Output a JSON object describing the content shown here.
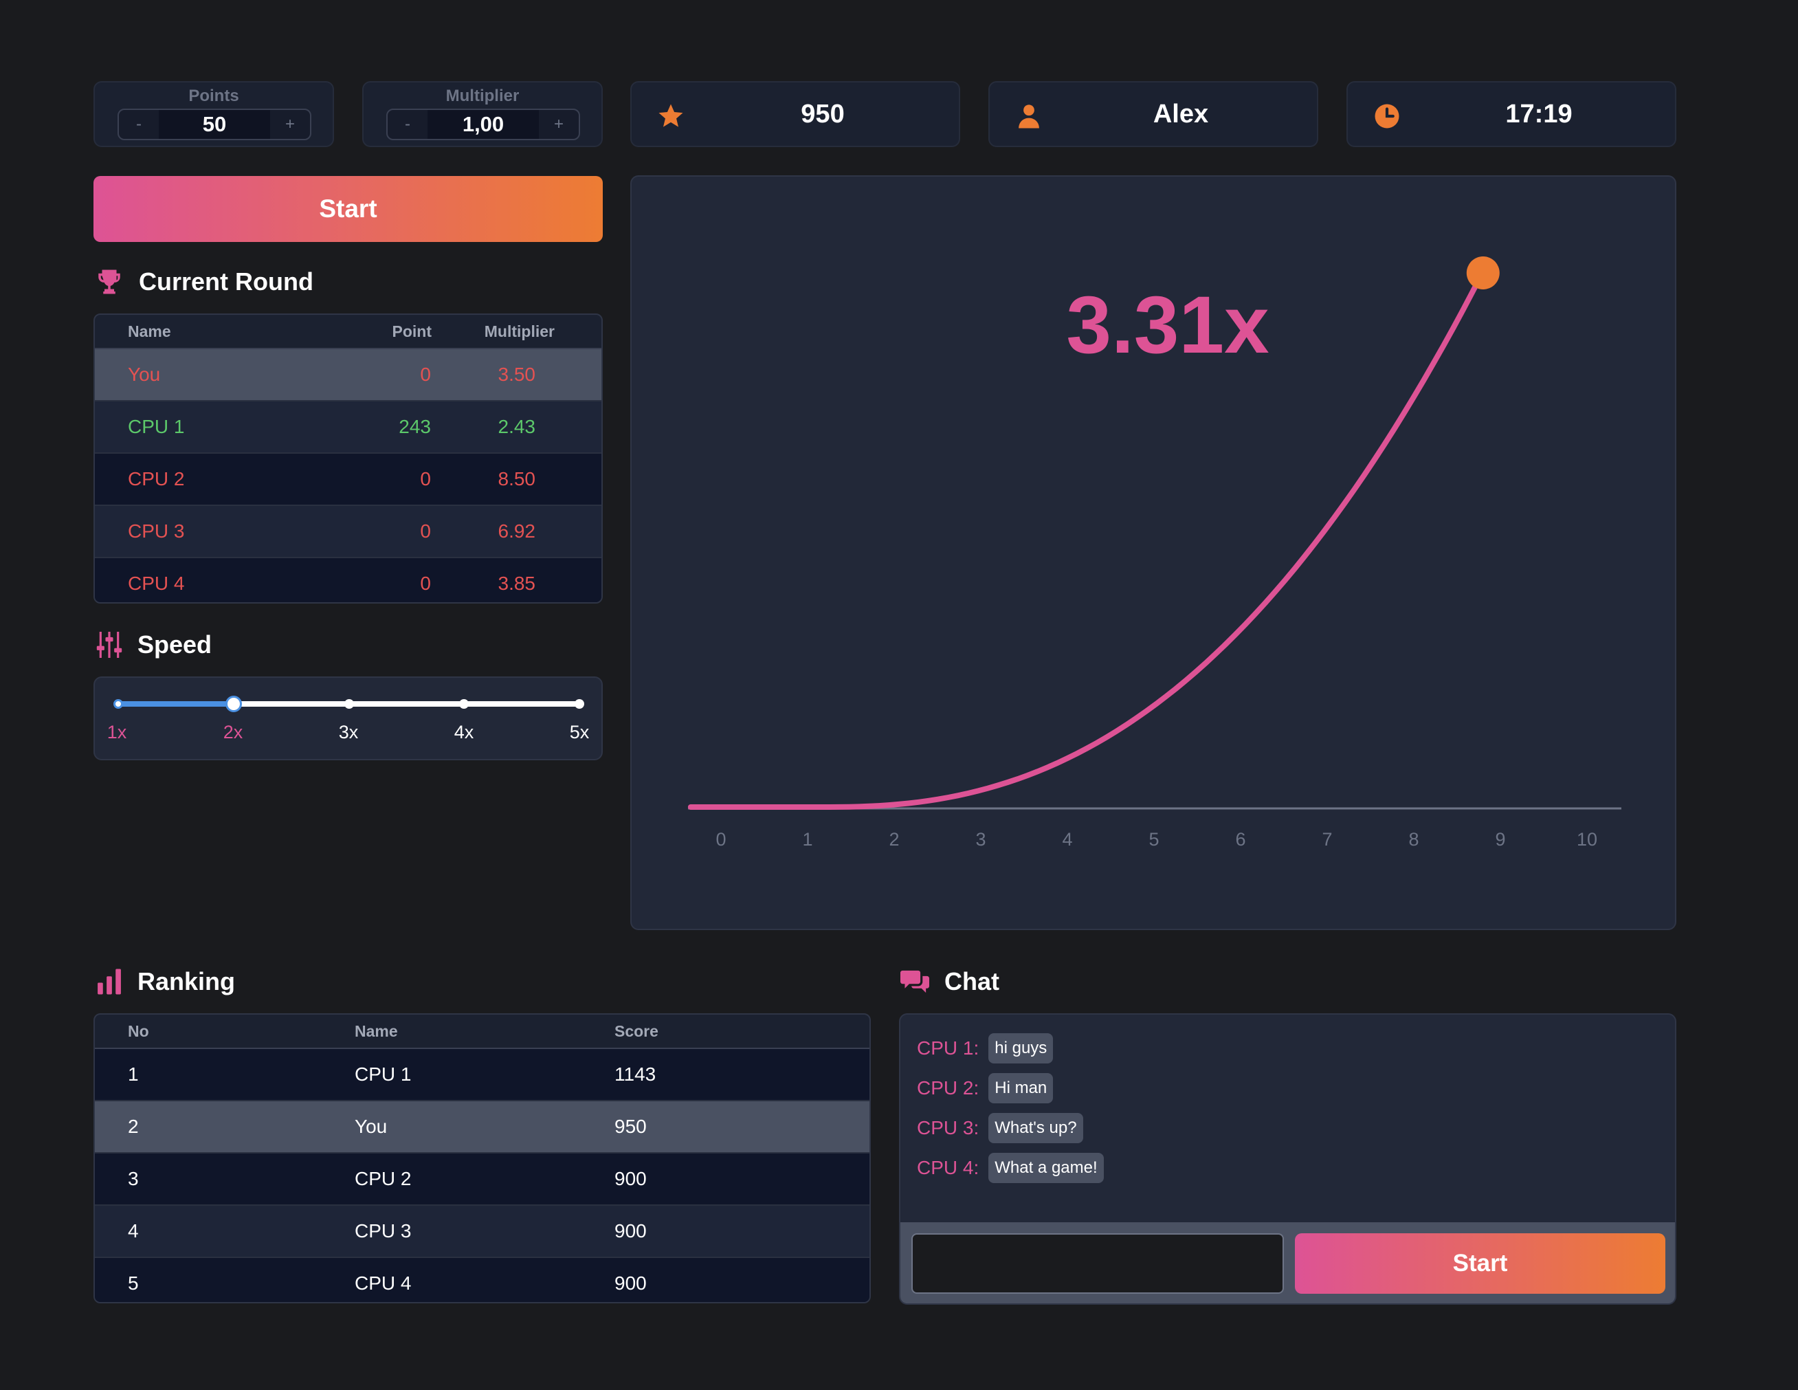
{
  "controls": {
    "points": {
      "label": "Points",
      "value": "50",
      "minus": "-",
      "plus": "+"
    },
    "multiplier": {
      "label": "Multiplier",
      "value": "1,00",
      "minus": "-",
      "plus": "+"
    }
  },
  "info": {
    "score": "950",
    "user": "Alex",
    "time": "17:19"
  },
  "start_label": "Start",
  "current_round": {
    "title": "Current Round",
    "columns": [
      "Name",
      "Point",
      "Multiplier"
    ],
    "rows": [
      {
        "name": "You",
        "point": "0",
        "multiplier": "3.50",
        "status": "red"
      },
      {
        "name": "CPU 1",
        "point": "243",
        "multiplier": "2.43",
        "status": "green"
      },
      {
        "name": "CPU 2",
        "point": "0",
        "multiplier": "8.50",
        "status": "red"
      },
      {
        "name": "CPU 3",
        "point": "0",
        "multiplier": "6.92",
        "status": "red"
      },
      {
        "name": "CPU 4",
        "point": "0",
        "multiplier": "3.85",
        "status": "red"
      }
    ]
  },
  "speed": {
    "title": "Speed",
    "options": [
      "1x",
      "2x",
      "3x",
      "4x",
      "5x"
    ],
    "selected": "2x"
  },
  "game": {
    "multiplier_display": "3.31x",
    "x_ticks": [
      "0",
      "1",
      "2",
      "3",
      "4",
      "5",
      "6",
      "7",
      "8",
      "9",
      "10"
    ],
    "curve_end_x": 8.8,
    "colors": {
      "curve": "#dd5395",
      "dot": "#ed7c33"
    }
  },
  "ranking": {
    "title": "Ranking",
    "columns": [
      "No",
      "Name",
      "Score"
    ],
    "rows": [
      {
        "no": "1",
        "name": "CPU 1",
        "score": "1143"
      },
      {
        "no": "2",
        "name": "You",
        "score": "950"
      },
      {
        "no": "3",
        "name": "CPU 2",
        "score": "900"
      },
      {
        "no": "4",
        "name": "CPU 3",
        "score": "900"
      },
      {
        "no": "5",
        "name": "CPU 4",
        "score": "900"
      }
    ]
  },
  "chat": {
    "title": "Chat",
    "messages": [
      {
        "who": "CPU 1:",
        "text": "hi guys"
      },
      {
        "who": "CPU 2:",
        "text": "Hi man"
      },
      {
        "who": "CPU 3:",
        "text": "What's up?"
      },
      {
        "who": "CPU 4:",
        "text": "What a game!"
      }
    ],
    "input_value": "",
    "send_label": "Start"
  },
  "theme": {
    "accent_pink": "#dd5395",
    "accent_orange": "#ed7c33",
    "slider_blue": "#4a90e2"
  }
}
